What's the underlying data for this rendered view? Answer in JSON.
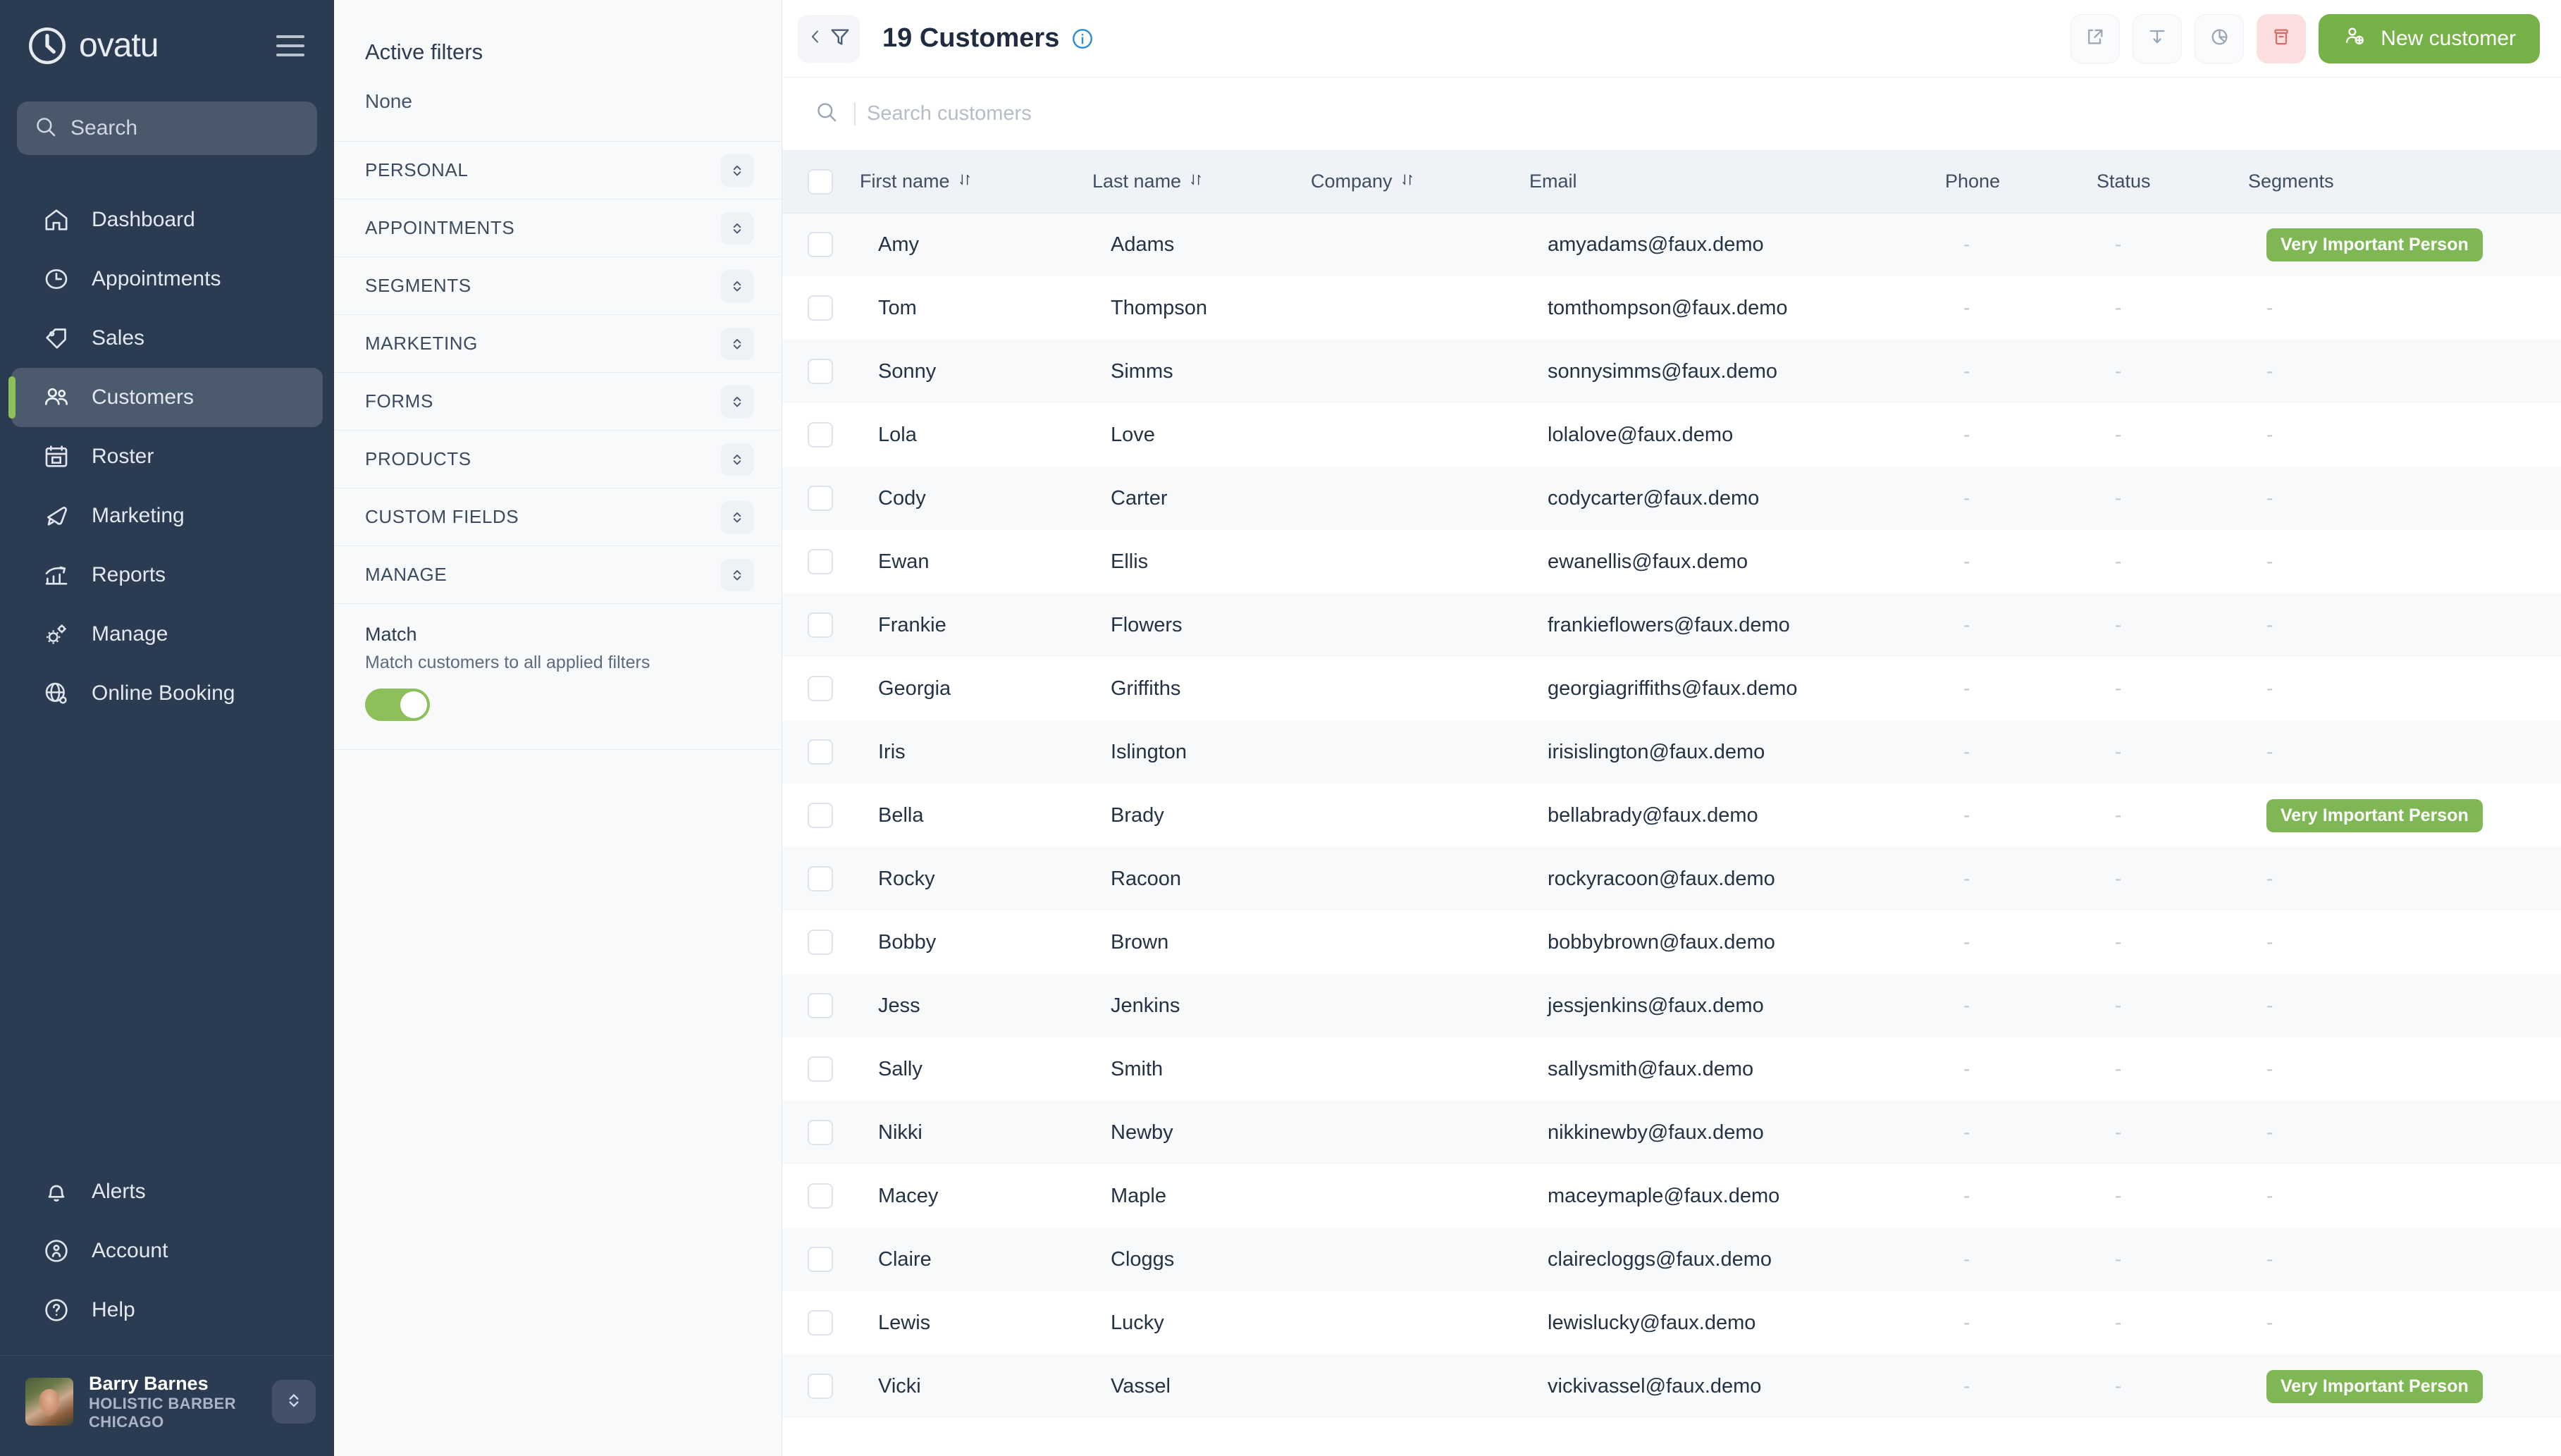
{
  "sidebar": {
    "brand": {
      "name": "ovatu",
      "logo_icon": "clock-logo-icon"
    },
    "menu_icon": "hamburger-icon",
    "search": {
      "placeholder": "Search",
      "icon": "search-icon"
    },
    "items": [
      {
        "label": "Dashboard",
        "icon": "home-icon",
        "active": false
      },
      {
        "label": "Appointments",
        "icon": "clock-icon",
        "active": false
      },
      {
        "label": "Sales",
        "icon": "tag-icon",
        "active": false
      },
      {
        "label": "Customers",
        "icon": "users-icon",
        "active": true
      },
      {
        "label": "Roster",
        "icon": "calendar-icon",
        "active": false
      },
      {
        "label": "Marketing",
        "icon": "megaphone-icon",
        "active": false
      },
      {
        "label": "Reports",
        "icon": "chart-icon",
        "active": false
      },
      {
        "label": "Manage",
        "icon": "gears-icon",
        "active": false
      },
      {
        "label": "Online Booking",
        "icon": "globe-gear-icon",
        "active": false
      }
    ],
    "bottom_items": [
      {
        "label": "Alerts",
        "icon": "bell-icon"
      },
      {
        "label": "Account",
        "icon": "person-circle-icon"
      },
      {
        "label": "Help",
        "icon": "question-circle-icon"
      }
    ],
    "profile": {
      "name": "Barry Barnes",
      "org": "HOLISTIC BARBER CHICAGO",
      "avatar_name": "user-avatar",
      "toggle_icon": "chevron-updown-icon"
    },
    "accent_color": "#8dc05a",
    "background_color": "#2b3b52"
  },
  "filters": {
    "title": "Active filters",
    "none_label": "None",
    "groups": [
      {
        "label": "PERSONAL"
      },
      {
        "label": "APPOINTMENTS"
      },
      {
        "label": "SEGMENTS"
      },
      {
        "label": "MARKETING"
      },
      {
        "label": "FORMS"
      },
      {
        "label": "PRODUCTS"
      },
      {
        "label": "CUSTOM FIELDS"
      },
      {
        "label": "MANAGE"
      }
    ],
    "match": {
      "title": "Match",
      "subtitle": "Match customers to all applied filters",
      "enabled": true,
      "on_color": "#8dc05a"
    },
    "caret_icon": "chevron-updown-icon"
  },
  "topbar": {
    "filter_toggle": {
      "icon_left": "chevron-left-icon",
      "icon_right": "funnel-icon"
    },
    "title": "19 Customers",
    "info_icon": "info-circle-icon",
    "actions": [
      {
        "name": "share-button",
        "icon": "share-icon"
      },
      {
        "name": "merge-button",
        "icon": "merge-arrow-icon"
      },
      {
        "name": "reports-button",
        "icon": "pie-chart-icon"
      },
      {
        "name": "archive-button",
        "icon": "archive-bin-icon",
        "color": "#e8817d"
      }
    ],
    "primary_button": {
      "label": "New customer",
      "icon": "user-plus-icon",
      "color": "#76b247"
    }
  },
  "search": {
    "placeholder": "Search customers",
    "value": "",
    "icon": "search-icon"
  },
  "table": {
    "columns": [
      {
        "key": "check",
        "label": "",
        "sortable": false
      },
      {
        "key": "first",
        "label": "First name",
        "sortable": true
      },
      {
        "key": "last",
        "label": "Last name",
        "sortable": true
      },
      {
        "key": "company",
        "label": "Company",
        "sortable": true
      },
      {
        "key": "email",
        "label": "Email",
        "sortable": false
      },
      {
        "key": "phone",
        "label": "Phone",
        "sortable": false
      },
      {
        "key": "status",
        "label": "Status",
        "sortable": false
      },
      {
        "key": "segments",
        "label": "Segments",
        "sortable": false
      }
    ],
    "sort_icon": "sort-updown-icon",
    "empty_value": "-",
    "rows": [
      {
        "first": "Amy",
        "last": "Adams",
        "company": "",
        "email": "amyadams@faux.demo",
        "phone": "-",
        "status": "-",
        "segments": [
          "Very Important Person"
        ]
      },
      {
        "first": "Tom",
        "last": "Thompson",
        "company": "",
        "email": "tomthompson@faux.demo",
        "phone": "-",
        "status": "-",
        "segments": []
      },
      {
        "first": "Sonny",
        "last": "Simms",
        "company": "",
        "email": "sonnysimms@faux.demo",
        "phone": "-",
        "status": "-",
        "segments": []
      },
      {
        "first": "Lola",
        "last": "Love",
        "company": "",
        "email": "lolalove@faux.demo",
        "phone": "-",
        "status": "-",
        "segments": []
      },
      {
        "first": "Cody",
        "last": "Carter",
        "company": "",
        "email": "codycarter@faux.demo",
        "phone": "-",
        "status": "-",
        "segments": []
      },
      {
        "first": "Ewan",
        "last": "Ellis",
        "company": "",
        "email": "ewanellis@faux.demo",
        "phone": "-",
        "status": "-",
        "segments": []
      },
      {
        "first": "Frankie",
        "last": "Flowers",
        "company": "",
        "email": "frankieflowers@faux.demo",
        "phone": "-",
        "status": "-",
        "segments": []
      },
      {
        "first": "Georgia",
        "last": "Griffiths",
        "company": "",
        "email": "georgiagriffiths@faux.demo",
        "phone": "-",
        "status": "-",
        "segments": []
      },
      {
        "first": "Iris",
        "last": "Islington",
        "company": "",
        "email": "irisislington@faux.demo",
        "phone": "-",
        "status": "-",
        "segments": []
      },
      {
        "first": "Bella",
        "last": "Brady",
        "company": "",
        "email": "bellabrady@faux.demo",
        "phone": "-",
        "status": "-",
        "segments": [
          "Very Important Person"
        ]
      },
      {
        "first": "Rocky",
        "last": "Racoon",
        "company": "",
        "email": "rockyracoon@faux.demo",
        "phone": "-",
        "status": "-",
        "segments": []
      },
      {
        "first": "Bobby",
        "last": "Brown",
        "company": "",
        "email": "bobbybrown@faux.demo",
        "phone": "-",
        "status": "-",
        "segments": []
      },
      {
        "first": "Jess",
        "last": "Jenkins",
        "company": "",
        "email": "jessjenkins@faux.demo",
        "phone": "-",
        "status": "-",
        "segments": []
      },
      {
        "first": "Sally",
        "last": "Smith",
        "company": "",
        "email": "sallysmith@faux.demo",
        "phone": "-",
        "status": "-",
        "segments": []
      },
      {
        "first": "Nikki",
        "last": "Newby",
        "company": "",
        "email": "nikkinewby@faux.demo",
        "phone": "-",
        "status": "-",
        "segments": []
      },
      {
        "first": "Macey",
        "last": "Maple",
        "company": "",
        "email": "maceymaple@faux.demo",
        "phone": "-",
        "status": "-",
        "segments": []
      },
      {
        "first": "Claire",
        "last": "Cloggs",
        "company": "",
        "email": "clairecloggs@faux.demo",
        "phone": "-",
        "status": "-",
        "segments": []
      },
      {
        "first": "Lewis",
        "last": "Lucky",
        "company": "",
        "email": "lewislucky@faux.demo",
        "phone": "-",
        "status": "-",
        "segments": []
      },
      {
        "first": "Vicki",
        "last": "Vassel",
        "company": "",
        "email": "vickivassel@faux.demo",
        "phone": "-",
        "status": "-",
        "segments": [
          "Very Important Person"
        ]
      }
    ]
  }
}
